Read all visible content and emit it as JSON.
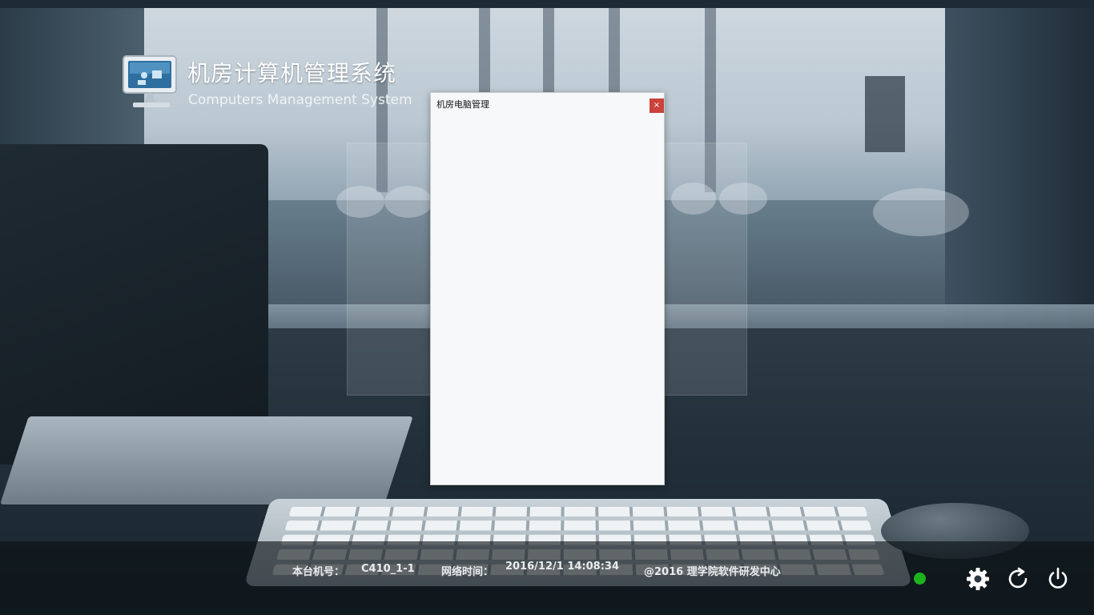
{
  "header": {
    "title": "机房计算机管理系统",
    "subtitle": "Computers Management System",
    "logo_icon": "computer-monitor-logo-icon"
  },
  "dialog": {
    "title": "机房电脑管理",
    "close_label": "×",
    "close_color": "#c9423b"
  },
  "footer": {
    "machine_label": "本台机号：",
    "machine_value": "C410_1-1",
    "time_label": "网络时间：",
    "time_value": "2016/12/1 14:08:34",
    "copyright": "@2016  理学院软件研发中心",
    "status_color": "#1db31f",
    "icons": [
      "gear-icon",
      "refresh-icon",
      "power-icon"
    ]
  }
}
